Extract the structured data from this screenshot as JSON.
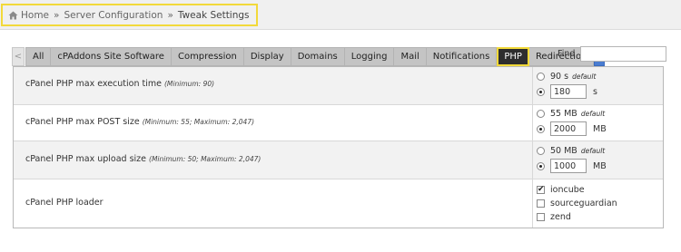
{
  "breadcrumb": {
    "home": "Home",
    "separator": "»",
    "section": "Server Configuration",
    "current": "Tweak Settings"
  },
  "tabs": {
    "prev_arrow": "<",
    "next_arrow": ">",
    "items": [
      {
        "label": "All"
      },
      {
        "label": "cPAddons Site Software"
      },
      {
        "label": "Compression"
      },
      {
        "label": "Display"
      },
      {
        "label": "Domains"
      },
      {
        "label": "Logging"
      },
      {
        "label": "Mail"
      },
      {
        "label": "Notifications"
      },
      {
        "label": "PHP",
        "active": true
      },
      {
        "label": "Redirection"
      }
    ]
  },
  "find": {
    "label": "Find",
    "value": ""
  },
  "settings": [
    {
      "label": "cPanel PHP max execution time",
      "hint": "(Minimum: 90)",
      "default_value": "90 s",
      "default_tag": "default",
      "custom_value": "180",
      "unit": "s",
      "selected": "custom"
    },
    {
      "label": "cPanel PHP max POST size",
      "hint": "(Minimum: 55; Maximum: 2,047)",
      "default_value": "55 MB",
      "default_tag": "default",
      "custom_value": "2000",
      "unit": "MB",
      "selected": "custom"
    },
    {
      "label": "cPanel PHP max upload size",
      "hint": "(Minimum: 50; Maximum: 2,047)",
      "default_value": "50 MB",
      "default_tag": "default",
      "custom_value": "1000",
      "unit": "MB",
      "selected": "custom"
    },
    {
      "label": "cPanel PHP loader",
      "options": [
        {
          "label": "ioncube",
          "checked": true
        },
        {
          "label": "sourceguardian",
          "checked": false
        },
        {
          "label": "zend",
          "checked": false
        }
      ]
    }
  ],
  "colors": {
    "highlight": "#f2d93a",
    "active_tab": "#2e2e2e",
    "next_arrow": "#4a7dd1"
  }
}
